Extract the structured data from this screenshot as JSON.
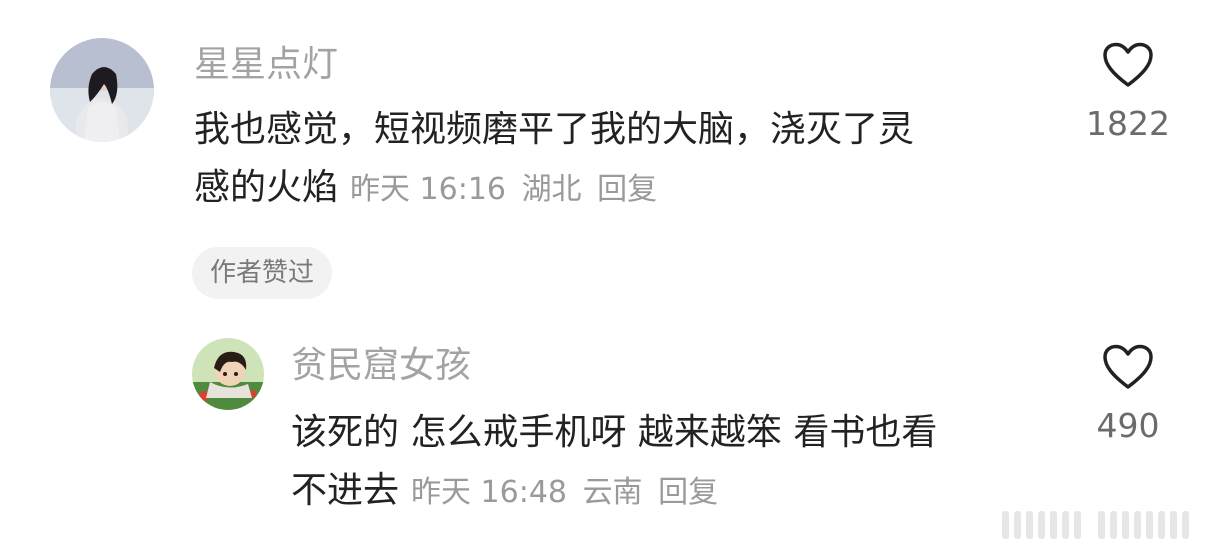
{
  "comments": [
    {
      "username": "星星点灯",
      "text_line1": "我也感觉，短视频磨平了我的大脑，浇灭了灵",
      "text_line2": "感的火焰",
      "time": "昨天 16:16",
      "location": "湖北",
      "reply": "回复",
      "likes": "1822",
      "badge": "作者赞过",
      "avatar_icon": "woman-in-snow-avatar"
    },
    {
      "username": "贫民窟女孩",
      "text_line1": "该死的 怎么戒手机呀 越来越笨 看书也看",
      "text_line2": "不进去",
      "time": "昨天 16:48",
      "location": "云南",
      "reply": "回复",
      "likes": "490",
      "avatar_icon": "anime-girl-avatar"
    }
  ],
  "colors": {
    "username": "#a3a3a3",
    "text": "#222222",
    "meta": "#9a9a9a",
    "badge_bg": "#f2f2f2"
  }
}
